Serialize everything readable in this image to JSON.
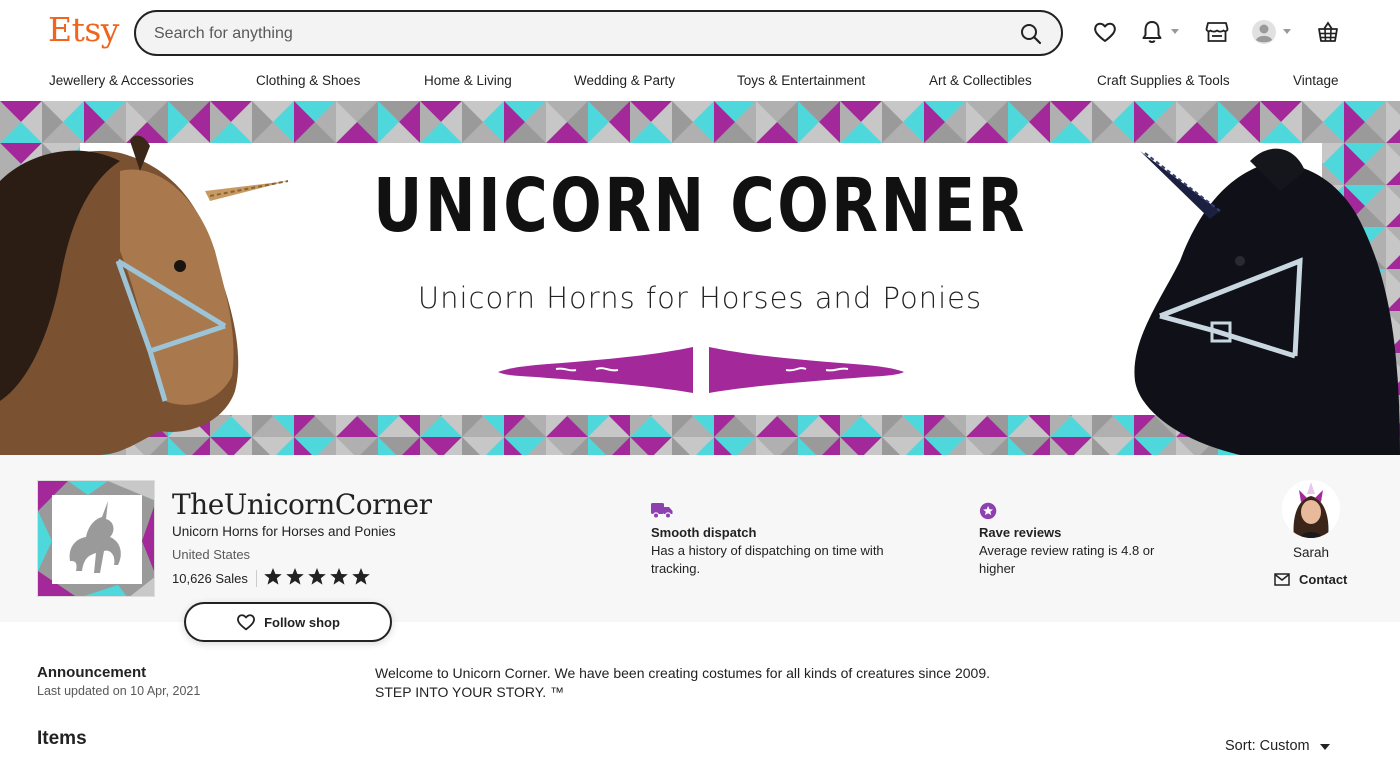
{
  "header": {
    "logo": "Etsy",
    "search_placeholder": "Search for anything",
    "icons": [
      "favorites-heart-icon",
      "notifications-bell-icon",
      "shop-manager-icon",
      "account-avatar-icon",
      "basket-icon"
    ]
  },
  "categories": [
    "Jewellery & Accessories",
    "Clothing & Shoes",
    "Home & Living",
    "Wedding & Party",
    "Toys & Entertainment",
    "Art & Collectibles",
    "Craft Supplies & Tools",
    "Vintage"
  ],
  "banner": {
    "title": "UNICORN CORNER",
    "subtitle": "Unicorn Horns for Horses and Ponies"
  },
  "shop": {
    "name": "TheUnicornCorner",
    "tagline": "Unicorn Horns for Horses and Ponies",
    "location": "United States",
    "sales": "10,626 Sales",
    "rating_stars": 5,
    "follow_label": "Follow shop"
  },
  "features": [
    {
      "title": "Smooth dispatch",
      "description": "Has a history of dispatching on time with tracking."
    },
    {
      "title": "Rave reviews",
      "description": "Average review rating is 4.8 or higher"
    }
  ],
  "owner": {
    "name": "Sarah",
    "contact_label": "Contact"
  },
  "announcement": {
    "title": "Announcement",
    "date": "Last updated on 10 Apr, 2021",
    "line1": "Welcome to Unicorn Corner. We have been creating costumes for all kinds of creatures since 2009.",
    "line2": "STEP INTO YOUR STORY. ™"
  },
  "items": {
    "title": "Items",
    "sort_label": "Sort: Custom"
  },
  "colors": {
    "brand": "#F1641E",
    "magenta": "#A3289A",
    "cyan": "#4ED8DB",
    "grey": "#9A9A9A",
    "feature_purple": "#8E3FB0"
  }
}
